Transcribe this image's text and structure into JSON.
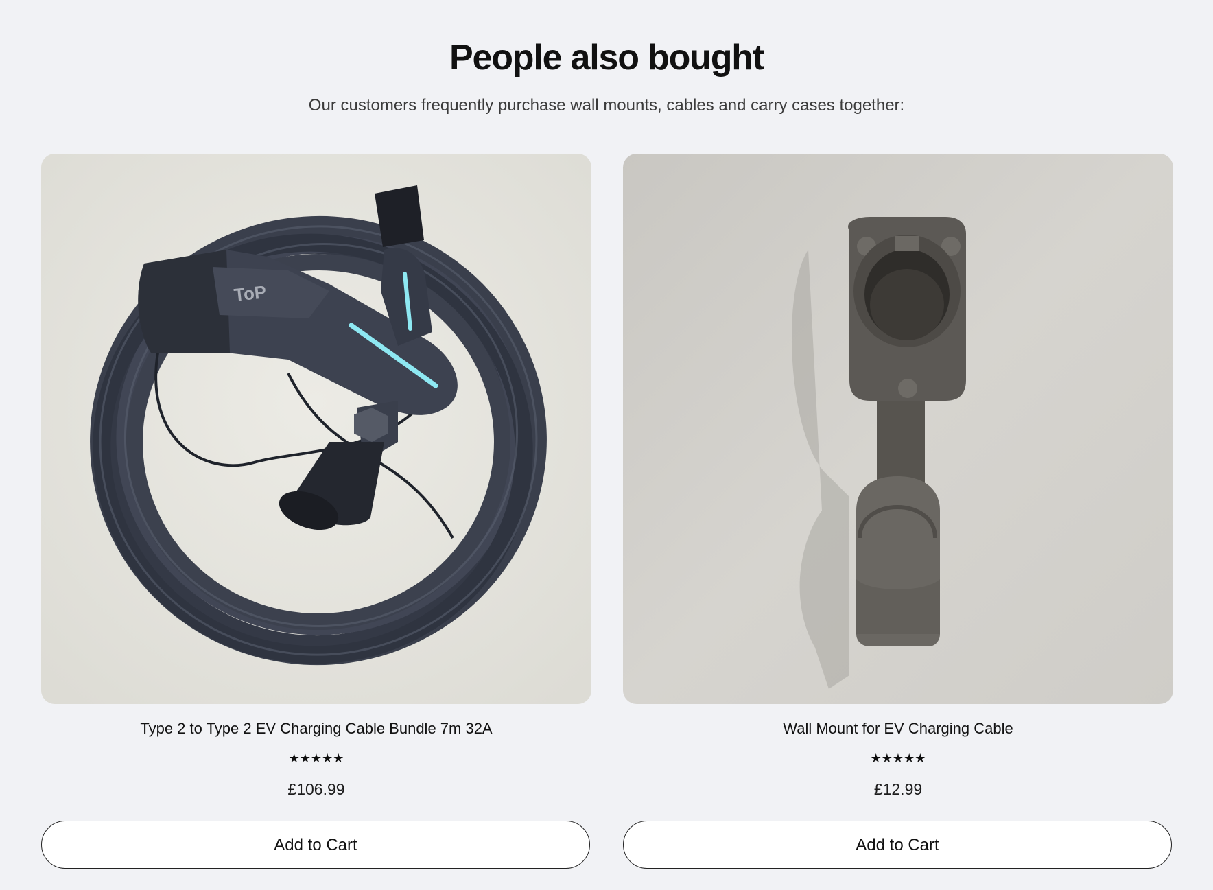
{
  "section": {
    "title": "People also bought",
    "subtitle": "Our customers frequently purchase wall mounts, cables and carry cases together:"
  },
  "products": [
    {
      "title": "Type 2 to Type 2 EV Charging Cable Bundle 7m 32A",
      "rating": 5,
      "stars": "★★★★★",
      "price": "£106.99",
      "button_label": "Add to Cart",
      "image_label": "ToP CHARGER"
    },
    {
      "title": "Wall Mount for EV Charging Cable",
      "rating": 5,
      "stars": "★★★★★",
      "price": "£12.99",
      "button_label": "Add to Cart"
    }
  ],
  "colors": {
    "background": "#f1f2f5",
    "button_bg": "#ffffff",
    "button_border": "#222222",
    "cable": "#3a3f4c",
    "led": "#8ee8f2",
    "mount": "#5c5955"
  }
}
